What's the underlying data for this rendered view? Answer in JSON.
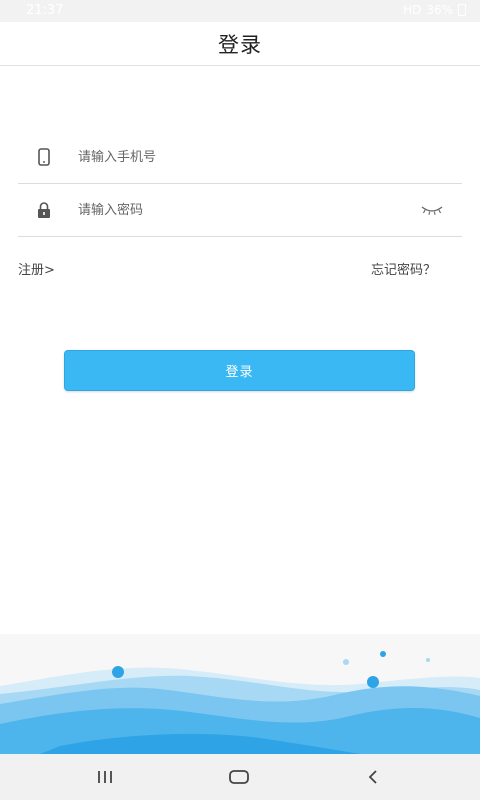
{
  "status_bar": {
    "time": "21:37",
    "network": "HD",
    "battery": "36%"
  },
  "header": {
    "title": "登录"
  },
  "form": {
    "phone_placeholder": "请输入手机号",
    "password_placeholder": "请输入密码",
    "phone_icon": "phone-icon",
    "lock_icon": "lock-icon",
    "visibility_icon": "eye-closed-icon"
  },
  "links": {
    "register": "注册>",
    "forgot_password": "忘记密码？"
  },
  "login_button": {
    "label": "登录",
    "color": "#3ab8f3"
  },
  "navigation": {
    "recent_icon": "recent-apps-icon",
    "home_icon": "home-icon",
    "back_icon": "back-icon"
  }
}
